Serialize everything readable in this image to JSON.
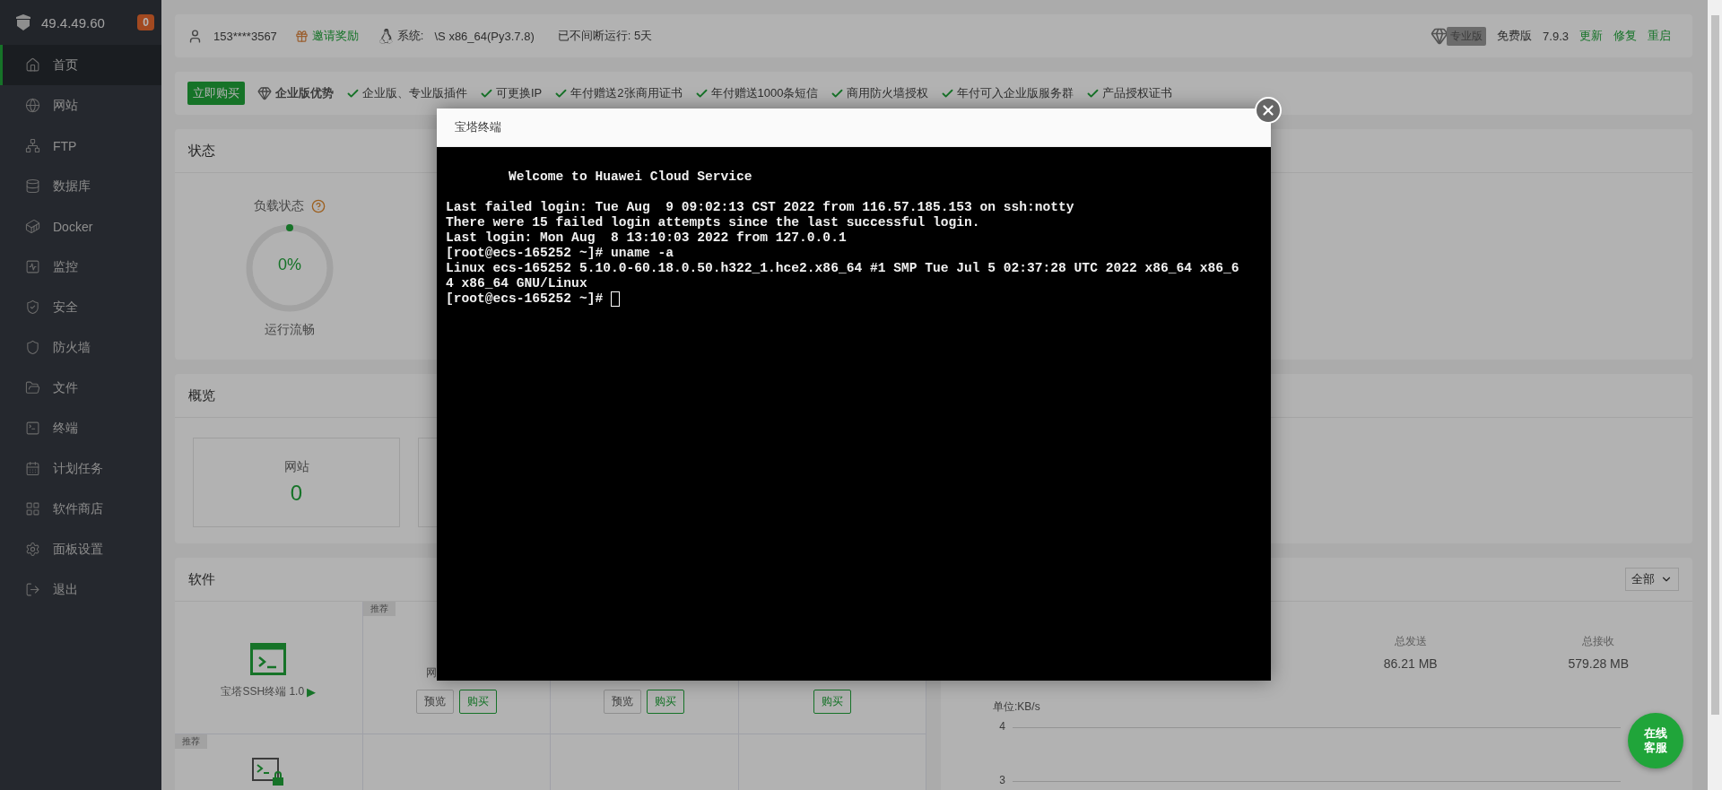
{
  "sidebar": {
    "host": "49.4.49.60",
    "badge": "0",
    "items": [
      {
        "label": "首页",
        "selected": true
      },
      {
        "label": "网站",
        "selected": false
      },
      {
        "label": "FTP",
        "selected": false
      },
      {
        "label": "数据库",
        "selected": false
      },
      {
        "label": "Docker",
        "selected": false
      },
      {
        "label": "监控",
        "selected": false
      },
      {
        "label": "安全",
        "selected": false
      },
      {
        "label": "防火墙",
        "selected": false
      },
      {
        "label": "文件",
        "selected": false
      },
      {
        "label": "终端",
        "selected": false
      },
      {
        "label": "计划任务",
        "selected": false
      },
      {
        "label": "软件商店",
        "selected": false
      },
      {
        "label": "面板设置",
        "selected": false
      },
      {
        "label": "退出",
        "selected": false
      }
    ]
  },
  "topbar": {
    "user": "153****3567",
    "invite": "邀请奖励",
    "system_label": "系统:",
    "system": "\\S x86_64(Py3.7.8)",
    "uptime": "已不间断运行: 5天",
    "pro_tag": "专业版",
    "edition": "免费版",
    "version": "7.9.3",
    "actions": [
      "更新",
      "修复",
      "重启"
    ]
  },
  "promo": {
    "buy": "立即购买",
    "title": "企业版优势",
    "features": [
      "企业版、专业版插件",
      "可更换IP",
      "年付赠送2张商用证书",
      "年付赠送1000条短信",
      "商用防火墙授权",
      "年付可入企业版服务群",
      "产品授权证书"
    ]
  },
  "status": {
    "title": "状态",
    "gauges": [
      {
        "label": "负载状态",
        "value": "0%",
        "caption": "运行流畅"
      }
    ]
  },
  "overview": {
    "title": "概览",
    "cards": [
      {
        "label": "网站",
        "value": "0"
      }
    ]
  },
  "software": {
    "title": "软件",
    "apps": [
      {
        "name": "宝塔SSH终端 1.0",
        "arrow": "▶"
      },
      {
        "name": "网",
        "tag": "推荐",
        "actions": [
          "预览",
          "购买"
        ]
      },
      {
        "actions": [
          "预览",
          "购买"
        ]
      },
      {
        "actions": [
          "购买"
        ]
      },
      {
        "tag": "推荐"
      }
    ]
  },
  "traffic": {
    "filter": "全部",
    "stats": [
      {
        "label": "总发送",
        "value": "86.21 MB"
      },
      {
        "label": "总接收",
        "value": "579.28 MB"
      }
    ],
    "unit": "单位:KB/s",
    "yticks": [
      "4",
      "3"
    ]
  },
  "terminal": {
    "title": "宝塔终端",
    "blocks": [
      [
        "        Welcome to Huawei Cloud Service"
      ],
      [
        "Last failed login: Tue Aug  9 09:02:13 CST 2022 from 116.57.185.153 on ssh:notty",
        "There were 15 failed login attempts since the last successful login.",
        "Last login: Mon Aug  8 13:10:03 2022 from 127.0.0.1",
        "[root@ecs-165252 ~]# uname -a",
        "Linux ecs-165252 5.10.0-60.18.0.50.h322_1.hce2.x86_64 #1 SMP Tue Jul 5 02:37:28 UTC 2022 x86_64 x86_6",
        "4 x86_64 GNU/Linux"
      ]
    ],
    "prompt": "[root@ecs-165252 ~]#"
  },
  "chat": {
    "lines": [
      "在线",
      "客服"
    ]
  }
}
